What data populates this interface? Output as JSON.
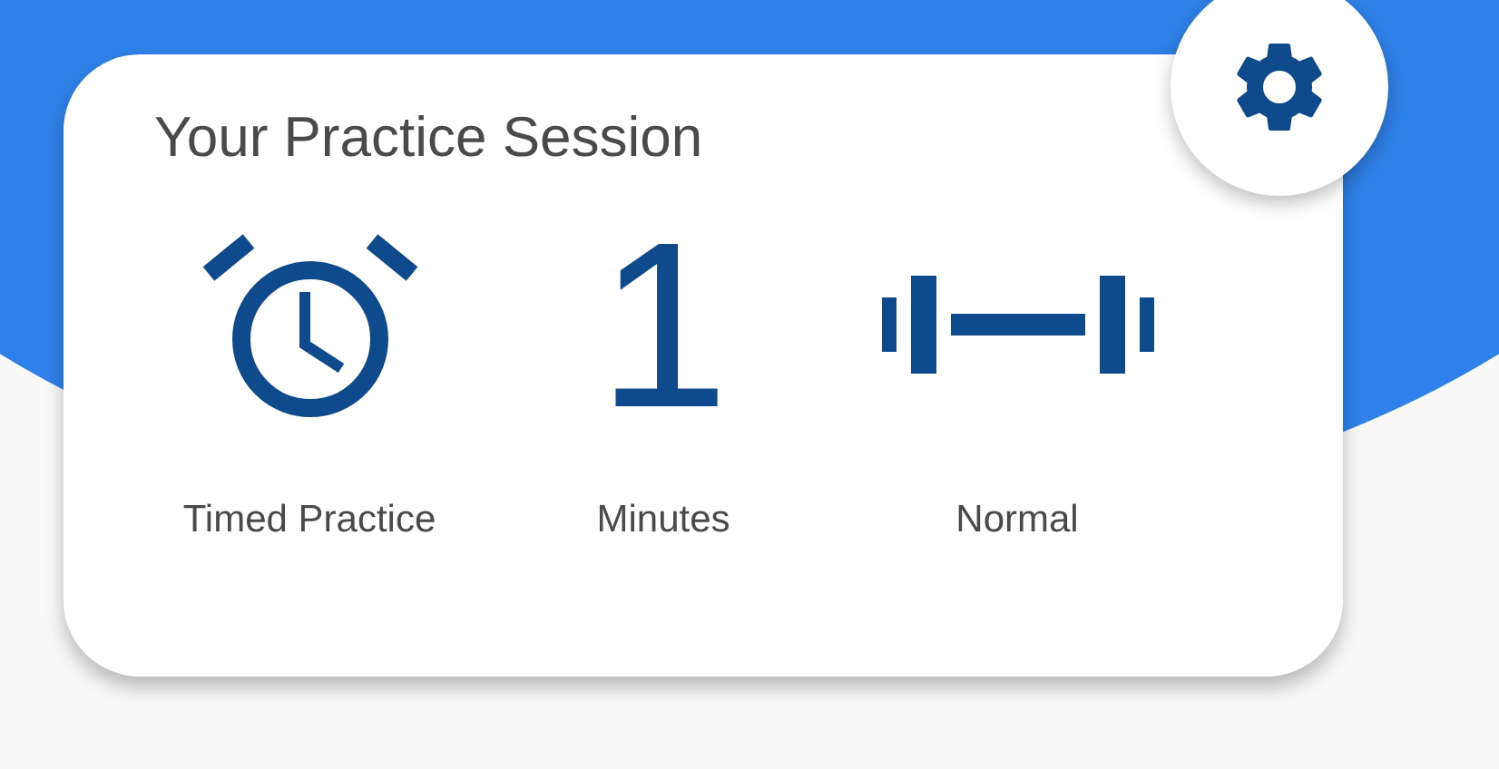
{
  "card": {
    "title": "Your Practice Session"
  },
  "options": [
    {
      "kind": "clock",
      "label": "Timed Practice"
    },
    {
      "kind": "value",
      "value": "1",
      "label": "Minutes"
    },
    {
      "kind": "dumbbell",
      "label": "Normal"
    }
  ]
}
